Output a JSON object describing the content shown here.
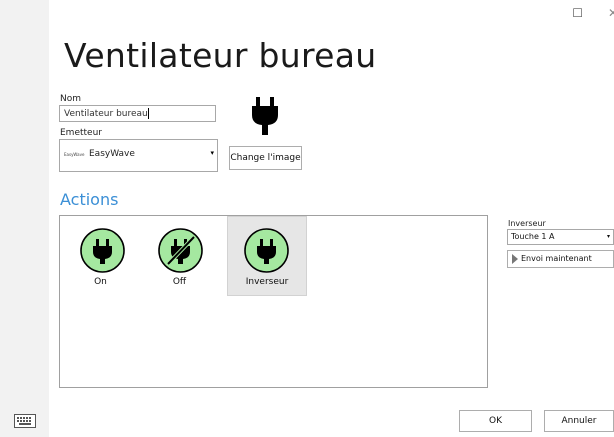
{
  "window": {
    "maximize_glyph": "☐",
    "close_glyph": "✕"
  },
  "page": {
    "title": "Ventilateur bureau"
  },
  "form": {
    "name_label": "Nom",
    "name_value": "Ventilateur bureau",
    "emitter_label": "Emetteur",
    "emitter_brand_logo": "EasyWave",
    "emitter_value": "EasyWave",
    "emitter_dropdown_glyph": "▾",
    "change_image_label": "Change l'image"
  },
  "actions": {
    "title": "Actions",
    "items": [
      {
        "label": "On",
        "icon": "plug-icon",
        "selected": false
      },
      {
        "label": "Off",
        "icon": "plug-off-icon",
        "selected": false
      },
      {
        "label": "Inverseur",
        "icon": "plug-icon",
        "selected": true
      }
    ]
  },
  "side_panel": {
    "label": "Inverseur",
    "select_value": "Touche 1 A",
    "select_dropdown_glyph": "▾",
    "send_button_label": "Envoi maintenant"
  },
  "footer": {
    "ok_label": "OK",
    "cancel_label": "Annuler"
  },
  "colors": {
    "accent": "#3b8fd6",
    "action_circle_fill": "#a5e8a0",
    "sidebar_bg": "#f2f2f2"
  }
}
